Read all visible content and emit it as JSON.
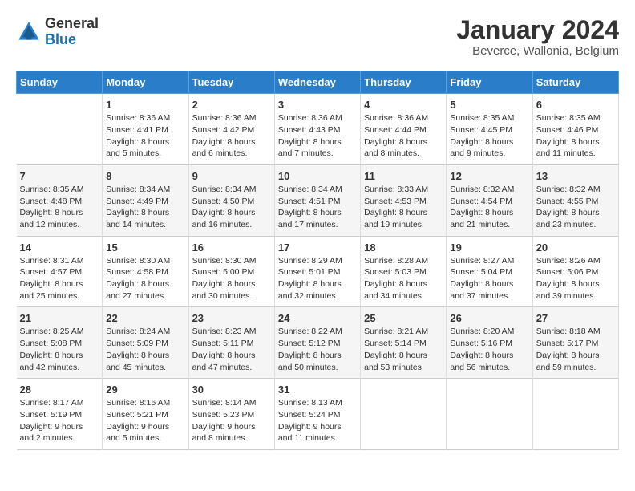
{
  "header": {
    "logo_general": "General",
    "logo_blue": "Blue",
    "month_title": "January 2024",
    "subtitle": "Beverce, Wallonia, Belgium"
  },
  "weekdays": [
    "Sunday",
    "Monday",
    "Tuesday",
    "Wednesday",
    "Thursday",
    "Friday",
    "Saturday"
  ],
  "weeks": [
    [
      {
        "day": "",
        "lines": []
      },
      {
        "day": "1",
        "lines": [
          "Sunrise: 8:36 AM",
          "Sunset: 4:41 PM",
          "Daylight: 8 hours",
          "and 5 minutes."
        ]
      },
      {
        "day": "2",
        "lines": [
          "Sunrise: 8:36 AM",
          "Sunset: 4:42 PM",
          "Daylight: 8 hours",
          "and 6 minutes."
        ]
      },
      {
        "day": "3",
        "lines": [
          "Sunrise: 8:36 AM",
          "Sunset: 4:43 PM",
          "Daylight: 8 hours",
          "and 7 minutes."
        ]
      },
      {
        "day": "4",
        "lines": [
          "Sunrise: 8:36 AM",
          "Sunset: 4:44 PM",
          "Daylight: 8 hours",
          "and 8 minutes."
        ]
      },
      {
        "day": "5",
        "lines": [
          "Sunrise: 8:35 AM",
          "Sunset: 4:45 PM",
          "Daylight: 8 hours",
          "and 9 minutes."
        ]
      },
      {
        "day": "6",
        "lines": [
          "Sunrise: 8:35 AM",
          "Sunset: 4:46 PM",
          "Daylight: 8 hours",
          "and 11 minutes."
        ]
      }
    ],
    [
      {
        "day": "7",
        "lines": [
          "Sunrise: 8:35 AM",
          "Sunset: 4:48 PM",
          "Daylight: 8 hours",
          "and 12 minutes."
        ]
      },
      {
        "day": "8",
        "lines": [
          "Sunrise: 8:34 AM",
          "Sunset: 4:49 PM",
          "Daylight: 8 hours",
          "and 14 minutes."
        ]
      },
      {
        "day": "9",
        "lines": [
          "Sunrise: 8:34 AM",
          "Sunset: 4:50 PM",
          "Daylight: 8 hours",
          "and 16 minutes."
        ]
      },
      {
        "day": "10",
        "lines": [
          "Sunrise: 8:34 AM",
          "Sunset: 4:51 PM",
          "Daylight: 8 hours",
          "and 17 minutes."
        ]
      },
      {
        "day": "11",
        "lines": [
          "Sunrise: 8:33 AM",
          "Sunset: 4:53 PM",
          "Daylight: 8 hours",
          "and 19 minutes."
        ]
      },
      {
        "day": "12",
        "lines": [
          "Sunrise: 8:32 AM",
          "Sunset: 4:54 PM",
          "Daylight: 8 hours",
          "and 21 minutes."
        ]
      },
      {
        "day": "13",
        "lines": [
          "Sunrise: 8:32 AM",
          "Sunset: 4:55 PM",
          "Daylight: 8 hours",
          "and 23 minutes."
        ]
      }
    ],
    [
      {
        "day": "14",
        "lines": [
          "Sunrise: 8:31 AM",
          "Sunset: 4:57 PM",
          "Daylight: 8 hours",
          "and 25 minutes."
        ]
      },
      {
        "day": "15",
        "lines": [
          "Sunrise: 8:30 AM",
          "Sunset: 4:58 PM",
          "Daylight: 8 hours",
          "and 27 minutes."
        ]
      },
      {
        "day": "16",
        "lines": [
          "Sunrise: 8:30 AM",
          "Sunset: 5:00 PM",
          "Daylight: 8 hours",
          "and 30 minutes."
        ]
      },
      {
        "day": "17",
        "lines": [
          "Sunrise: 8:29 AM",
          "Sunset: 5:01 PM",
          "Daylight: 8 hours",
          "and 32 minutes."
        ]
      },
      {
        "day": "18",
        "lines": [
          "Sunrise: 8:28 AM",
          "Sunset: 5:03 PM",
          "Daylight: 8 hours",
          "and 34 minutes."
        ]
      },
      {
        "day": "19",
        "lines": [
          "Sunrise: 8:27 AM",
          "Sunset: 5:04 PM",
          "Daylight: 8 hours",
          "and 37 minutes."
        ]
      },
      {
        "day": "20",
        "lines": [
          "Sunrise: 8:26 AM",
          "Sunset: 5:06 PM",
          "Daylight: 8 hours",
          "and 39 minutes."
        ]
      }
    ],
    [
      {
        "day": "21",
        "lines": [
          "Sunrise: 8:25 AM",
          "Sunset: 5:08 PM",
          "Daylight: 8 hours",
          "and 42 minutes."
        ]
      },
      {
        "day": "22",
        "lines": [
          "Sunrise: 8:24 AM",
          "Sunset: 5:09 PM",
          "Daylight: 8 hours",
          "and 45 minutes."
        ]
      },
      {
        "day": "23",
        "lines": [
          "Sunrise: 8:23 AM",
          "Sunset: 5:11 PM",
          "Daylight: 8 hours",
          "and 47 minutes."
        ]
      },
      {
        "day": "24",
        "lines": [
          "Sunrise: 8:22 AM",
          "Sunset: 5:12 PM",
          "Daylight: 8 hours",
          "and 50 minutes."
        ]
      },
      {
        "day": "25",
        "lines": [
          "Sunrise: 8:21 AM",
          "Sunset: 5:14 PM",
          "Daylight: 8 hours",
          "and 53 minutes."
        ]
      },
      {
        "day": "26",
        "lines": [
          "Sunrise: 8:20 AM",
          "Sunset: 5:16 PM",
          "Daylight: 8 hours",
          "and 56 minutes."
        ]
      },
      {
        "day": "27",
        "lines": [
          "Sunrise: 8:18 AM",
          "Sunset: 5:17 PM",
          "Daylight: 8 hours",
          "and 59 minutes."
        ]
      }
    ],
    [
      {
        "day": "28",
        "lines": [
          "Sunrise: 8:17 AM",
          "Sunset: 5:19 PM",
          "Daylight: 9 hours",
          "and 2 minutes."
        ]
      },
      {
        "day": "29",
        "lines": [
          "Sunrise: 8:16 AM",
          "Sunset: 5:21 PM",
          "Daylight: 9 hours",
          "and 5 minutes."
        ]
      },
      {
        "day": "30",
        "lines": [
          "Sunrise: 8:14 AM",
          "Sunset: 5:23 PM",
          "Daylight: 9 hours",
          "and 8 minutes."
        ]
      },
      {
        "day": "31",
        "lines": [
          "Sunrise: 8:13 AM",
          "Sunset: 5:24 PM",
          "Daylight: 9 hours",
          "and 11 minutes."
        ]
      },
      {
        "day": "",
        "lines": []
      },
      {
        "day": "",
        "lines": []
      },
      {
        "day": "",
        "lines": []
      }
    ]
  ]
}
